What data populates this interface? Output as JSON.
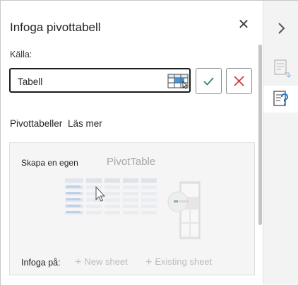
{
  "pane": {
    "title": "Infoga pivottabell",
    "source_label": "Källa:",
    "source_value": "Tabell",
    "section_heading": "Pivottabeller",
    "learn_more": "Läs mer",
    "card": {
      "create_own": "Skapa en egen",
      "pivot_label": "PivotTable",
      "insert_label": "Infoga på:",
      "new_sheet": "New sheet",
      "existing_sheet": "Existing sheet"
    }
  },
  "icons": {
    "close": "close-icon",
    "select_range": "table-select-icon",
    "confirm": "checkmark-icon",
    "cancel": "x-icon",
    "rail_expand": "chevron-right-icon",
    "rail_pivot_fields": "pivot-fields-icon",
    "rail_help": "table-help-icon"
  },
  "colors": {
    "confirm": "#2e8b57",
    "cancel": "#d13438",
    "accent": "#2b78c2",
    "disabled_text": "#bdbdbd"
  }
}
